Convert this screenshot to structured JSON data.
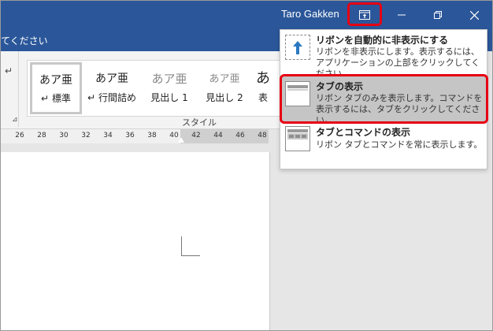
{
  "titlebar": {
    "user_name": "Taro Gakken",
    "icons": {
      "ribbon_display": "ribbon-display-options-icon",
      "minimize": "minimize-icon",
      "maximize": "restore-icon",
      "close": "close-icon"
    },
    "highlight_color": "#e60012",
    "bar_color": "#2b579a"
  },
  "tabstrip": {
    "tell_me_fragment": "てください"
  },
  "ribbon": {
    "group_label": "スタイル",
    "styles": [
      {
        "sample": "あア亜",
        "label": "標準",
        "mark": "↵"
      },
      {
        "sample": "あア亜",
        "label": "行間詰め",
        "mark": "↵"
      },
      {
        "sample": "あア亜",
        "label": "見出し 1"
      },
      {
        "sample": "あア亜",
        "label": "見出し 2"
      },
      {
        "sample": "あ",
        "label": "表"
      }
    ]
  },
  "ruler": {
    "numbers": [
      "26",
      "28",
      "30",
      "32",
      "34",
      "36",
      "38",
      "40",
      "42",
      "44",
      "46",
      "48"
    ]
  },
  "menu": {
    "items": [
      {
        "title": "リボンを自動的に非表示にする",
        "desc": "リボンを非表示にします。表示するには、アプリケーションの上部をクリックしてください。",
        "icon": "auto-hide-ribbon-icon"
      },
      {
        "title": "タブの表示",
        "desc": "リボン タブのみを表示します。コマンドを表示するには、タブをクリックしてください。",
        "icon": "show-tabs-icon"
      },
      {
        "title": "タブとコマンドの表示",
        "desc": "リボン タブとコマンドを常に表示します。",
        "icon": "show-tabs-and-commands-icon"
      }
    ]
  }
}
